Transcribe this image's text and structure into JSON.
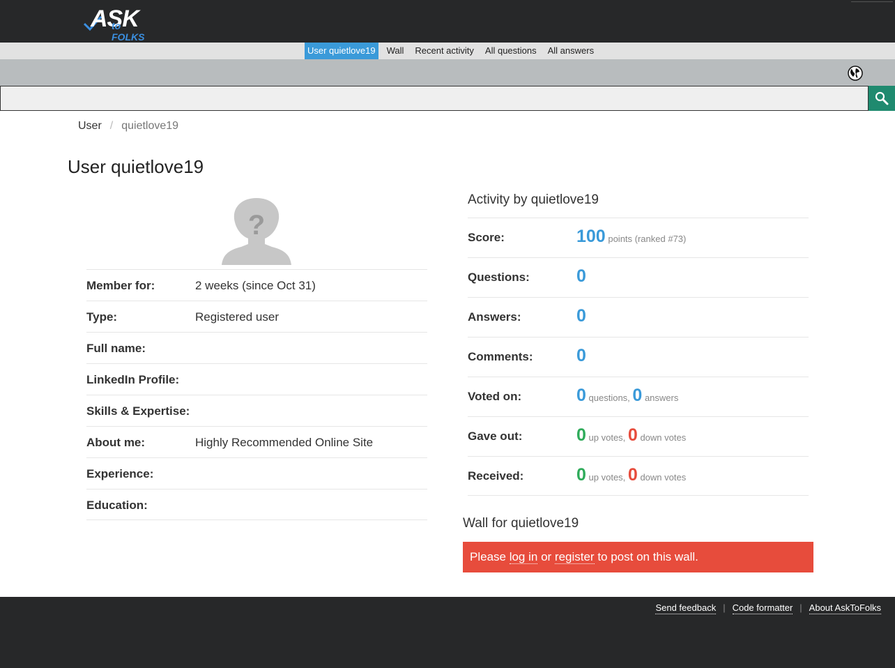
{
  "header": {
    "logo_big": "ASK",
    "logo_small": "to FOLKS"
  },
  "nav": {
    "items": [
      {
        "label": "User quietlove19",
        "active": true
      },
      {
        "label": "Wall"
      },
      {
        "label": "Recent activity"
      },
      {
        "label": "All questions"
      },
      {
        "label": "All answers"
      }
    ]
  },
  "search": {
    "value": "",
    "placeholder": ""
  },
  "breadcrumb": {
    "root": "User",
    "current": "quietlove19"
  },
  "page_title": "User quietlove19",
  "profile": {
    "rows": [
      {
        "label": "Member for:",
        "value": "2 weeks (since Oct 31)"
      },
      {
        "label": "Type:",
        "value": "Registered user"
      },
      {
        "label": "Full name:",
        "value": ""
      },
      {
        "label": "LinkedIn Profile:",
        "value": ""
      },
      {
        "label": "Skills & Expertise:",
        "value": ""
      },
      {
        "label": "About me:",
        "value": "Highly Recommended Online Site"
      },
      {
        "label": "Experience:",
        "value": ""
      },
      {
        "label": "Education:",
        "value": ""
      }
    ]
  },
  "activity": {
    "title": "Activity by quietlove19",
    "score": {
      "label": "Score:",
      "value": "100",
      "suffix": "points (ranked #73)"
    },
    "questions": {
      "label": "Questions:",
      "value": "0"
    },
    "answers": {
      "label": "Answers:",
      "value": "0"
    },
    "comments": {
      "label": "Comments:",
      "value": "0"
    },
    "voted_on": {
      "label": "Voted on:",
      "q_value": "0",
      "q_text": "questions,",
      "a_value": "0",
      "a_text": "answers"
    },
    "gave_out": {
      "label": "Gave out:",
      "up_value": "0",
      "up_text": "up votes,",
      "down_value": "0",
      "down_text": "down votes"
    },
    "received": {
      "label": "Received:",
      "up_value": "0",
      "up_text": "up votes,",
      "down_value": "0",
      "down_text": "down votes"
    }
  },
  "wall": {
    "title": "Wall for quietlove19",
    "msg_before": "Please ",
    "login_label": "log in",
    "msg_or": " or ",
    "register_label": "register",
    "msg_after": " to post on this wall."
  },
  "footer": {
    "links": [
      "Send feedback",
      "Code formatter",
      "About AskToFolks"
    ]
  },
  "colors": {
    "topbar": "#272829",
    "nav_active": "#3a9ad9",
    "search_button": "#1f8a6f",
    "points_blue": "#3a9ad9",
    "up_green": "#2eab5a",
    "down_red": "#e74c3c",
    "wall_alert": "#e74c3c"
  },
  "icons": [
    "logo-checkmark-icon",
    "globe-icon",
    "search-icon",
    "anonymous-avatar-icon"
  ]
}
